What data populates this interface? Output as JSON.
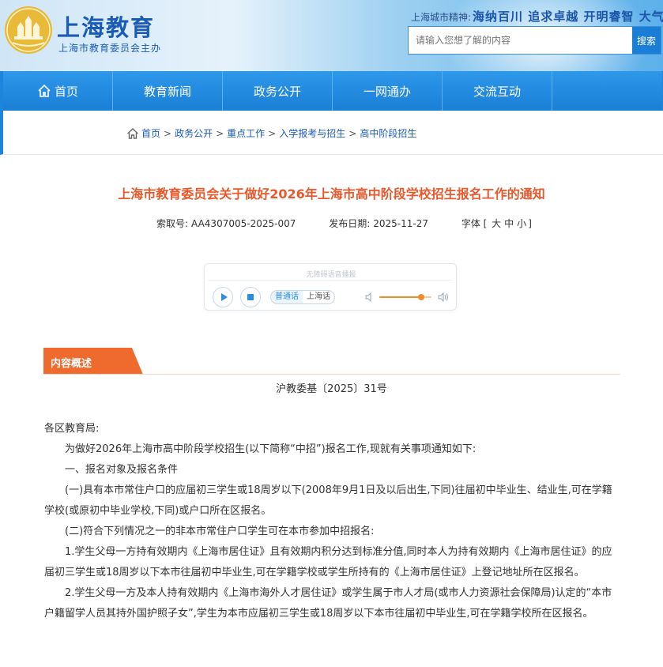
{
  "header": {
    "site_title": "上海教育",
    "site_subtitle": "上海市教育委员会主办",
    "spirit_label": "上海城市精神:",
    "spirit_motto": "海纳百川 追求卓越 开明睿智 大气谦和",
    "search_placeholder": "请输入您想了解的内容",
    "search_button": "搜索"
  },
  "nav": {
    "items": [
      {
        "label": "首页"
      },
      {
        "label": "教育新闻"
      },
      {
        "label": "政务公开"
      },
      {
        "label": "一网通办"
      },
      {
        "label": "交流互动"
      }
    ]
  },
  "breadcrumb": {
    "items": [
      "首页",
      "政务公开",
      "重点工作",
      "入学报考与招生",
      "高中阶段招生"
    ],
    "separator": ">"
  },
  "article": {
    "title": "上海市教育委员会关于做好2026年上海市高中阶段学校招生报名工作的通知",
    "index_label": "索取号:",
    "index_value": "AA4307005-2025-007",
    "date_label": "发布日期:",
    "date_value": "2025-11-27",
    "font_label": "字体",
    "font_sizes": [
      "大",
      "中",
      "小"
    ]
  },
  "player": {
    "caption": "无障碍语音播报",
    "lang_mandarin": "普通话",
    "lang_shanghai": "上海话",
    "volume": 0.8
  },
  "section": {
    "tag": "内容概述",
    "doc_number": "沪教委基〔2025〕31号"
  },
  "paragraphs": [
    "各区教育局:",
    "为做好2026年上海市高中阶段学校招生(以下简称“中招”)报名工作,现就有关事项通知如下:",
    "一、报名对象及报名条件",
    "(一)具有本市常住户口的应届初三学生或18周岁以下(2008年9月1日及以后出生,下同)往届初中毕业生、结业生,可在学籍学校(或原初中毕业学校,下同)或户口所在区报名。",
    "(二)符合下列情况之一的非本市常住户口学生可在本市参加中招报名:",
    "1.学生父母一方持有效期内《上海市居住证》且有效期内积分达到标准分值,同时本人为持有效期内《上海市居住证》的应届初三学生或18周岁以下本市往届初中毕业生,可在学籍学校或学生所持有的《上海市居住证》上登记地址所在区报名。",
    "2.学生父母一方及本人持有效期内《上海市海外人才居住证》或学生属于市人才局(或市人力资源社会保障局)认定的“本市户籍留学人员其持外国护照子女”,学生为本市应届初三学生或18周岁以下本市往届初中毕业生,可在学籍学校所在区报名。"
  ]
}
